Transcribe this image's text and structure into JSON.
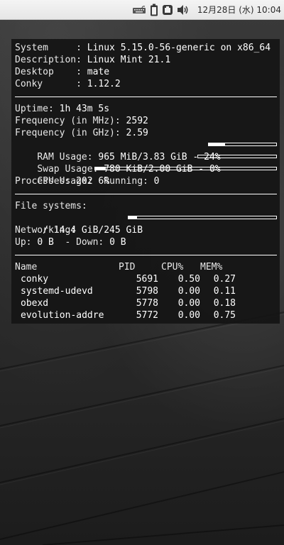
{
  "tray": {
    "clock": "12月28日 (水) 10:04",
    "icons": [
      "keyboard-icon",
      "battery-icon",
      "network-icon",
      "volume-icon"
    ]
  },
  "conky": {
    "system": {
      "system_label": "System     : ",
      "system_value": "Linux 5.15.0-56-generic on x86_64",
      "description_label": "Description: ",
      "description_value": "Linux Mint 21.1",
      "desktop_label": "Desktop    : ",
      "desktop_value": "mate",
      "conky_label": "Conky      : ",
      "conky_value": "1.12.2"
    },
    "stats": {
      "uptime_label": "Uptime: ",
      "uptime_value": "1h 43m 5s",
      "freq_mhz_label": "Frequency (in MHz): ",
      "freq_mhz_value": "2592",
      "freq_ghz_label": "Frequency (in GHz): ",
      "freq_ghz_value": "2.59",
      "ram_label": "RAM Usage: ",
      "ram_value": "965 MiB/3.83 GiB - 24%",
      "ram_percent": 24,
      "swap_label": "Swap Usage: ",
      "swap_value": "780 KiB/2.00 GiB - 0%",
      "swap_percent": 0,
      "cpu_label": "CPU Usage: ",
      "cpu_value": "6%",
      "cpu_percent": 6,
      "processes_label": "Processes: ",
      "processes_value": "202",
      "running_label": "  Running: ",
      "running_value": "0"
    },
    "filesystems": {
      "header": "File systems:",
      "root_value": " / 14.4 GiB/245 GiB",
      "root_percent": 6,
      "networking_header": "Networking:",
      "up_label": "Up: ",
      "up_value": "0 B",
      "down_label": "  - Down: ",
      "down_value": "0 B"
    },
    "processes": {
      "headers": [
        "Name",
        "PID",
        "CPU%",
        "MEM%"
      ],
      "rows": [
        {
          "name": "conky",
          "pid": "5691",
          "cpu": "0.50",
          "mem": "0.27"
        },
        {
          "name": "systemd-udevd",
          "pid": "5798",
          "cpu": "0.00",
          "mem": "0.11"
        },
        {
          "name": "obexd",
          "pid": "5778",
          "cpu": "0.00",
          "mem": "0.18"
        },
        {
          "name": "evolution-addre",
          "pid": "5772",
          "cpu": "0.00",
          "mem": "0.75"
        }
      ]
    }
  }
}
